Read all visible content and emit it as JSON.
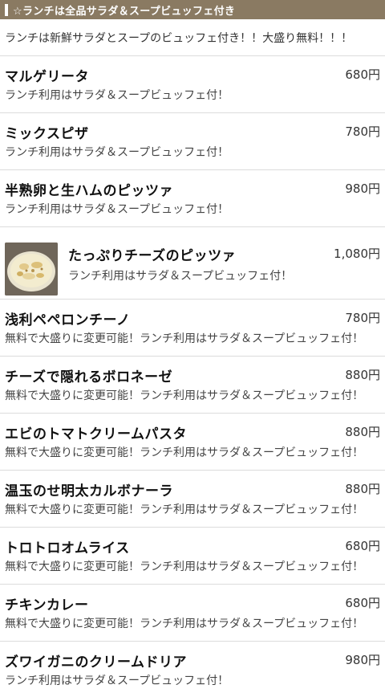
{
  "header": {
    "title": "☆ランチは全品サラダ＆スープビュッフェ付き"
  },
  "intro": "ランチは新鮮サラダとスープのビュッフェ付き！！大盛り無料！！！",
  "items": [
    {
      "name": "マルゲリータ",
      "price": "680円",
      "desc": "ランチ利用はサラダ＆スープビュッフェ付！"
    },
    {
      "name": "ミックスピザ",
      "price": "780円",
      "desc": "ランチ利用はサラダ＆スープビュッフェ付！"
    },
    {
      "name": "半熟卵と生ハムのピッツァ",
      "price": "980円",
      "desc": "ランチ利用はサラダ＆スープビュッフェ付！"
    },
    {
      "name": "たっぷりチーズのピッツァ",
      "price": "1,080円",
      "desc": "ランチ利用はサラダ＆スープビュッフェ付！"
    },
    {
      "name": "浅利ペペロンチーノ",
      "price": "780円",
      "desc": "無料で大盛りに変更可能！ランチ利用はサラダ＆スープビュッフェ付！"
    },
    {
      "name": "チーズで隠れるボロネーゼ",
      "price": "880円",
      "desc": "無料で大盛りに変更可能！ランチ利用はサラダ＆スープビュッフェ付！"
    },
    {
      "name": "エビのトマトクリームパスタ",
      "price": "880円",
      "desc": "無料で大盛りに変更可能！ランチ利用はサラダ＆スープビュッフェ付！"
    },
    {
      "name": "温玉のせ明太カルボナーラ",
      "price": "880円",
      "desc": "無料で大盛りに変更可能！ランチ利用はサラダ＆スープビュッフェ付！"
    },
    {
      "name": "トロトロオムライス",
      "price": "680円",
      "desc": "無料で大盛りに変更可能！ランチ利用はサラダ＆スープビュッフェ付！"
    },
    {
      "name": "チキンカレー",
      "price": "680円",
      "desc": "無料で大盛りに変更可能！ランチ利用はサラダ＆スープビュッフェ付！"
    },
    {
      "name": "ズワイガニのクリームドリア",
      "price": "980円",
      "desc": "ランチ利用はサラダ＆スープビュッフェ付！"
    }
  ]
}
